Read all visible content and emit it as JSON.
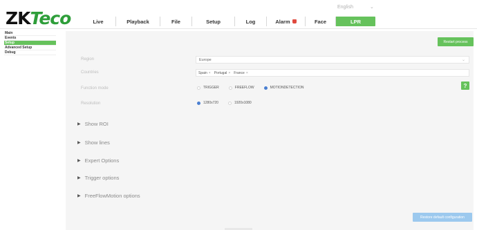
{
  "logo": {
    "brand_a": "ZK",
    "brand_b": "Teco"
  },
  "language": {
    "label": "English",
    "caret": "⌄"
  },
  "tabs": [
    {
      "label": "Live"
    },
    {
      "label": "Playback"
    },
    {
      "label": "File"
    },
    {
      "label": "Setup"
    },
    {
      "label": "Log"
    },
    {
      "label": "Alarm"
    },
    {
      "label": "Face"
    },
    {
      "label": "LPR"
    }
  ],
  "sidebar": {
    "items": [
      {
        "label": "Main"
      },
      {
        "label": "Events"
      },
      {
        "label": "Setup"
      },
      {
        "label": "Advanced Setup"
      },
      {
        "label": "Debug"
      }
    ]
  },
  "main": {
    "restart_button": "Restart process",
    "region": {
      "label": "Region",
      "value": "Europe"
    },
    "countries": {
      "label": "Countries",
      "tags": [
        "Spain",
        "Portugal",
        "France"
      ],
      "remove_glyph": "×"
    },
    "function_mode": {
      "label": "Function mode",
      "options": [
        "TRIGGER",
        "FREEFLOW",
        "MOTIONDETECTION"
      ],
      "selected": "MOTIONDETECTION"
    },
    "resolution": {
      "label": "Resolution",
      "options": [
        "1280x720",
        "1920x1080"
      ],
      "selected": "1280x720"
    },
    "help_label": "?",
    "expanders": [
      {
        "label": "Show ROI"
      },
      {
        "label": "Show lines"
      },
      {
        "label": "Expert Options"
      },
      {
        "label": "Trigger options"
      },
      {
        "label": "FreeFlowMotion options"
      }
    ],
    "expander_glyph": "▶",
    "default_button": "Restore default configuration"
  },
  "colors": {
    "accent": "#66c25c",
    "selected_radio": "#4a7fd1",
    "default_button": "#9cc9ee"
  }
}
